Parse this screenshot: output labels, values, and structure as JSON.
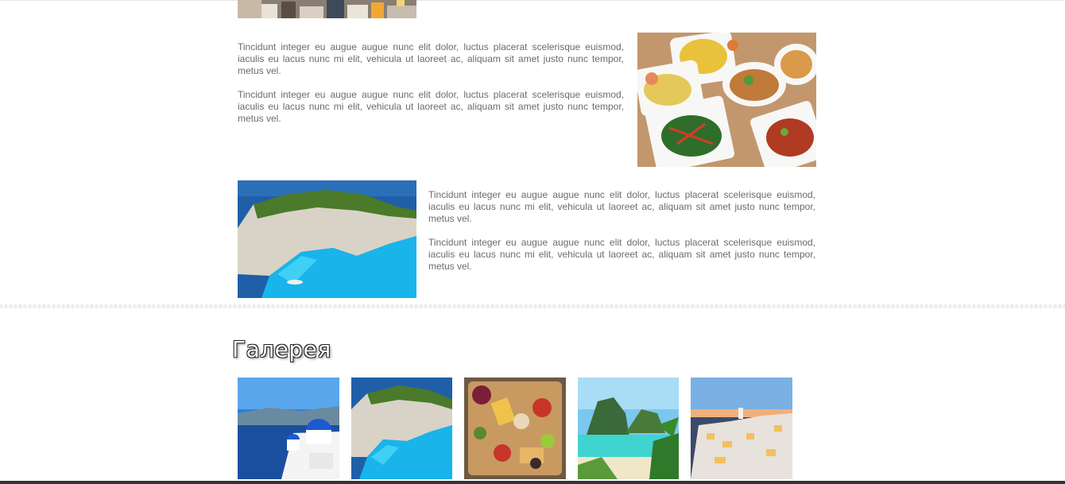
{
  "sections": {
    "food": {
      "paragraphs": [
        "Tincidunt integer eu augue augue nunc elit dolor, luctus placerat scelerisque euismod, iaculis eu lacus nunc mi elit, vehicula ut laoreet ac, aliquam sit amet justo nunc tempor, metus vel.",
        "Tincidunt integer eu augue augue nunc elit dolor, luctus placerat scelerisque euismod, iaculis eu lacus nunc mi elit, vehicula ut laoreet ac, aliquam sit amet justo nunc tempor, metus vel."
      ],
      "image_icon": "food-dishes-image"
    },
    "beach": {
      "paragraphs": [
        "Tincidunt integer eu augue augue nunc elit dolor, luctus placerat scelerisque euismod, iaculis eu lacus nunc mi elit, vehicula ut laoreet ac, aliquam sit amet justo nunc tempor, metus vel.",
        "Tincidunt integer eu augue augue nunc elit dolor, luctus placerat scelerisque euismod, iaculis eu lacus nunc mi elit, vehicula ut laoreet ac, aliquam sit amet justo nunc tempor, metus vel."
      ],
      "image_icon": "cove-beach-image"
    }
  },
  "gallery": {
    "title": "Галерея",
    "items": [
      {
        "icon": "santorini-domes-image"
      },
      {
        "icon": "cove-beach-image"
      },
      {
        "icon": "food-platter-image"
      },
      {
        "icon": "tropical-beach-image"
      },
      {
        "icon": "santorini-sunset-image"
      }
    ]
  },
  "colors": {
    "text": "#6b6b6b",
    "sea": "#1aa3e0",
    "sky": "#3a7fd0"
  }
}
